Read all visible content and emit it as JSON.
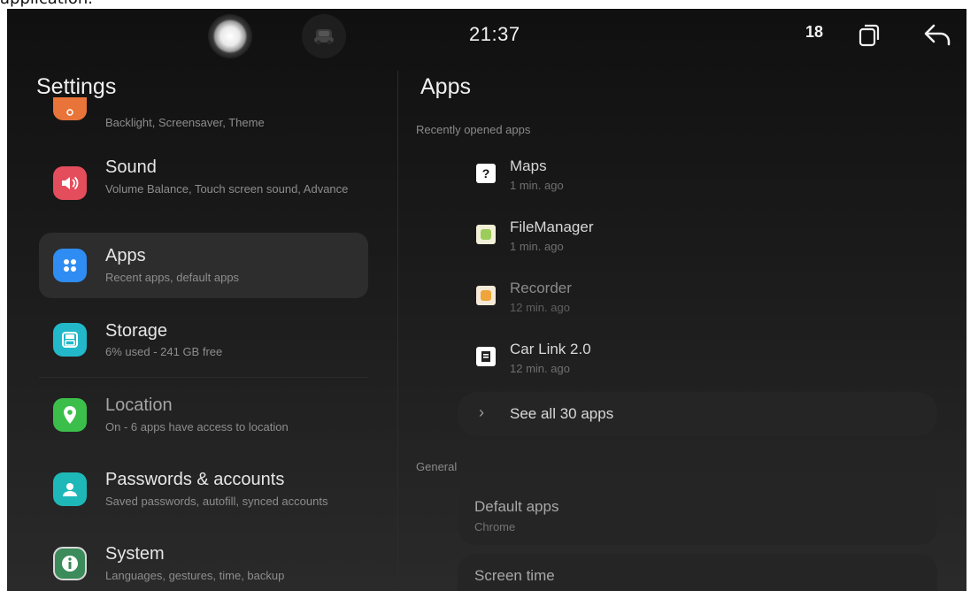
{
  "caption_fragment": "application.",
  "status_bar": {
    "time": "21:37",
    "badge": "18",
    "icons": [
      "assistant-orb-icon",
      "car-icon",
      "recent-apps-icon",
      "back-arrow-icon"
    ]
  },
  "left_pane": {
    "title": "Settings",
    "items": [
      {
        "label": "",
        "subtitle": "Backlight, Screensaver, Theme",
        "icon": "display-icon",
        "color": "#e8743a"
      },
      {
        "label": "Sound",
        "subtitle": "Volume Balance, Touch screen sound, Advance",
        "icon": "speaker-icon",
        "color": "#e44d5c"
      },
      {
        "label": "Apps",
        "subtitle": "Recent apps, default apps",
        "icon": "apps-grid-icon",
        "color": "#2f8cf2",
        "selected": true
      },
      {
        "label": "Storage",
        "subtitle": "6% used - 241 GB free",
        "icon": "storage-icon",
        "color": "#22b8c9"
      },
      {
        "label": "Location",
        "subtitle": "On - 6 apps have access to location",
        "icon": "location-pin-icon",
        "color": "#3bbf4a"
      },
      {
        "label": "Passwords & accounts",
        "subtitle": "Saved passwords, autofill, synced accounts",
        "icon": "account-icon",
        "color": "#1fb8b8"
      },
      {
        "label": "System",
        "subtitle": "Languages, gestures, time, backup",
        "icon": "info-icon",
        "color": "#3c8b5b"
      }
    ]
  },
  "right_pane": {
    "title": "Apps",
    "recent_header": "Recently opened apps",
    "recent_apps": [
      {
        "name": "Maps",
        "time": "1 min. ago",
        "icon": "maps-icon"
      },
      {
        "name": "FileManager",
        "time": "1 min. ago",
        "icon": "file-manager-icon"
      },
      {
        "name": "Recorder",
        "time": "12 min. ago",
        "icon": "recorder-icon"
      },
      {
        "name": "Car Link 2.0",
        "time": "12 min. ago",
        "icon": "car-link-icon"
      }
    ],
    "see_all": "See all 30 apps",
    "general_header": "General",
    "default_apps": {
      "title": "Default apps",
      "value": "Chrome"
    },
    "screen_time": {
      "title": "Screen time"
    }
  }
}
